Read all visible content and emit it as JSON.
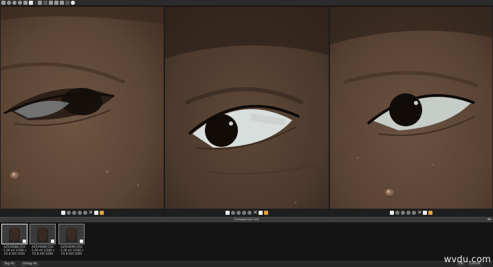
{
  "toolbar": {
    "icons": [
      "zoom-in-icon",
      "zoom-out-icon",
      "zoom-fit-icon",
      "magnify-icon",
      "rotate-icon",
      "crop-icon",
      "compare-icon",
      "grid-icon",
      "layout-icon",
      "monitor-icon",
      "info-icon",
      "sync-icon",
      "white-balance-icon"
    ]
  },
  "panes": [
    {
      "id": "pane1",
      "subject": "eye closeup"
    },
    {
      "id": "pane2",
      "subject": "eye closeup"
    },
    {
      "id": "pane3",
      "subject": "eye closeup"
    }
  ],
  "comparison_list": {
    "title": "Comparison List",
    "thumbnails": [
      {
        "name": "AZ5V6088.CR2",
        "exposure": "-1.00 eV  1/160 s",
        "settings": "f/2.8  ISO 1600"
      },
      {
        "name": "AZ5V6089.CR2",
        "exposure": "-1.00 eV  1/160 s",
        "settings": "f/2.8  ISO 1600"
      },
      {
        "name": "AZ5V6090.CR2",
        "exposure": "-1.00 eV  1/160 s",
        "settings": "f/2.8  ISO 1600"
      }
    ]
  },
  "status": {
    "tag_all": "Tag All",
    "untag_all": "Untag All",
    "ok": "OK",
    "cancel": "Cancel"
  },
  "watermark": "wvdu.com"
}
